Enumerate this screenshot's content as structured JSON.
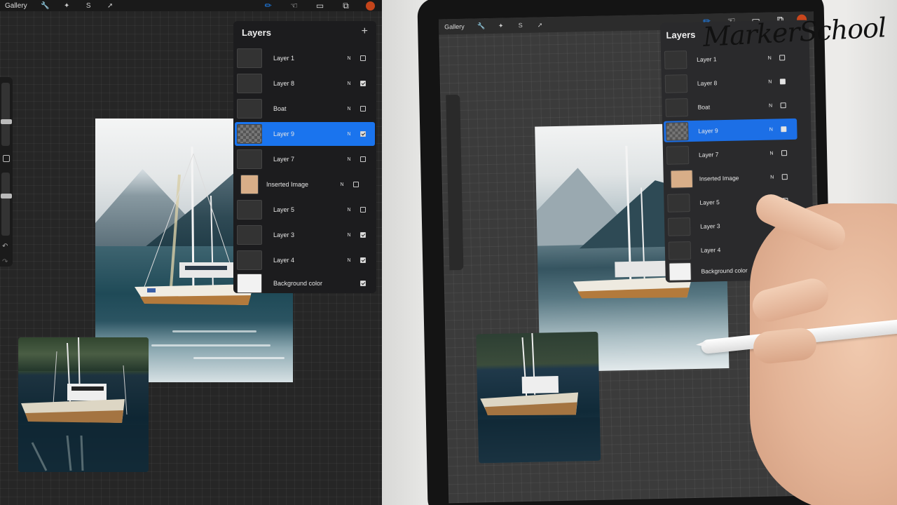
{
  "toolbar": {
    "gallery_label": "Gallery",
    "left_icons": [
      "wrench-icon",
      "magic-wand-icon",
      "selection-icon",
      "transform-arrow-icon"
    ],
    "right_icons": [
      "brush-icon",
      "smudge-icon",
      "eraser-icon",
      "layers-icon"
    ],
    "accent_color": "#1e88ff",
    "current_color": "#c4441a"
  },
  "layers_panel": {
    "title": "Layers",
    "add_symbol": "+",
    "layers": [
      {
        "name": "Layer 1",
        "mode": "N",
        "visible": false,
        "selected": false
      },
      {
        "name": "Layer 8",
        "mode": "N",
        "visible": true,
        "selected": false
      },
      {
        "name": "Boat",
        "mode": "N",
        "visible": false,
        "selected": false
      },
      {
        "name": "Layer 9",
        "mode": "N",
        "visible": true,
        "selected": true
      },
      {
        "name": "Layer 7",
        "mode": "N",
        "visible": false,
        "selected": false
      },
      {
        "name": "Inserted Image",
        "mode": "N",
        "visible": false,
        "selected": false
      },
      {
        "name": "Layer 5",
        "mode": "N",
        "visible": false,
        "selected": false
      },
      {
        "name": "Layer 3",
        "mode": "N",
        "visible": true,
        "selected": false
      },
      {
        "name": "Layer 4",
        "mode": "N",
        "visible": true,
        "selected": false
      },
      {
        "name": "Background color",
        "mode": "",
        "visible": true,
        "selected": false
      }
    ]
  },
  "photo_side": {
    "gallery_label": "Gallery",
    "layers_title": "Layers",
    "watermark": "MarkerSchool",
    "layers": [
      {
        "name": "Layer 1",
        "mode": "N"
      },
      {
        "name": "Layer 8",
        "mode": "N"
      },
      {
        "name": "Boat",
        "mode": "N"
      },
      {
        "name": "Layer 9",
        "mode": "N"
      },
      {
        "name": "Layer 7",
        "mode": "N"
      },
      {
        "name": "Inserted Image",
        "mode": "N"
      },
      {
        "name": "Layer 5",
        "mode": "N"
      },
      {
        "name": "Layer 3",
        "mode": ""
      },
      {
        "name": "Layer 4",
        "mode": "N"
      },
      {
        "name": "Background color",
        "mode": ""
      }
    ]
  }
}
